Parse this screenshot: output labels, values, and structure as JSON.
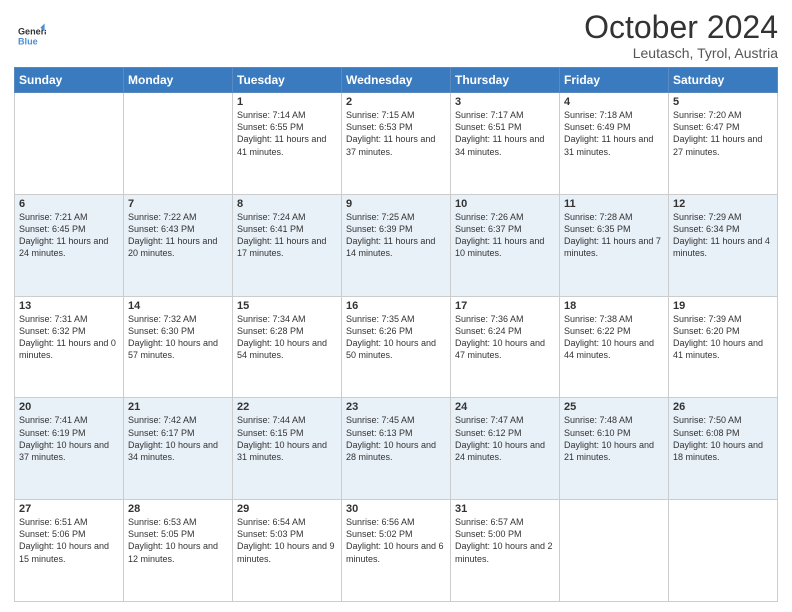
{
  "header": {
    "logo": {
      "line1": "General",
      "line2": "Blue"
    },
    "title": "October 2024",
    "location": "Leutasch, Tyrol, Austria"
  },
  "weekdays": [
    "Sunday",
    "Monday",
    "Tuesday",
    "Wednesday",
    "Thursday",
    "Friday",
    "Saturday"
  ],
  "weeks": [
    [
      {
        "day": "",
        "info": ""
      },
      {
        "day": "",
        "info": ""
      },
      {
        "day": "1",
        "info": "Sunrise: 7:14 AM\nSunset: 6:55 PM\nDaylight: 11 hours and 41 minutes."
      },
      {
        "day": "2",
        "info": "Sunrise: 7:15 AM\nSunset: 6:53 PM\nDaylight: 11 hours and 37 minutes."
      },
      {
        "day": "3",
        "info": "Sunrise: 7:17 AM\nSunset: 6:51 PM\nDaylight: 11 hours and 34 minutes."
      },
      {
        "day": "4",
        "info": "Sunrise: 7:18 AM\nSunset: 6:49 PM\nDaylight: 11 hours and 31 minutes."
      },
      {
        "day": "5",
        "info": "Sunrise: 7:20 AM\nSunset: 6:47 PM\nDaylight: 11 hours and 27 minutes."
      }
    ],
    [
      {
        "day": "6",
        "info": "Sunrise: 7:21 AM\nSunset: 6:45 PM\nDaylight: 11 hours and 24 minutes."
      },
      {
        "day": "7",
        "info": "Sunrise: 7:22 AM\nSunset: 6:43 PM\nDaylight: 11 hours and 20 minutes."
      },
      {
        "day": "8",
        "info": "Sunrise: 7:24 AM\nSunset: 6:41 PM\nDaylight: 11 hours and 17 minutes."
      },
      {
        "day": "9",
        "info": "Sunrise: 7:25 AM\nSunset: 6:39 PM\nDaylight: 11 hours and 14 minutes."
      },
      {
        "day": "10",
        "info": "Sunrise: 7:26 AM\nSunset: 6:37 PM\nDaylight: 11 hours and 10 minutes."
      },
      {
        "day": "11",
        "info": "Sunrise: 7:28 AM\nSunset: 6:35 PM\nDaylight: 11 hours and 7 minutes."
      },
      {
        "day": "12",
        "info": "Sunrise: 7:29 AM\nSunset: 6:34 PM\nDaylight: 11 hours and 4 minutes."
      }
    ],
    [
      {
        "day": "13",
        "info": "Sunrise: 7:31 AM\nSunset: 6:32 PM\nDaylight: 11 hours and 0 minutes."
      },
      {
        "day": "14",
        "info": "Sunrise: 7:32 AM\nSunset: 6:30 PM\nDaylight: 10 hours and 57 minutes."
      },
      {
        "day": "15",
        "info": "Sunrise: 7:34 AM\nSunset: 6:28 PM\nDaylight: 10 hours and 54 minutes."
      },
      {
        "day": "16",
        "info": "Sunrise: 7:35 AM\nSunset: 6:26 PM\nDaylight: 10 hours and 50 minutes."
      },
      {
        "day": "17",
        "info": "Sunrise: 7:36 AM\nSunset: 6:24 PM\nDaylight: 10 hours and 47 minutes."
      },
      {
        "day": "18",
        "info": "Sunrise: 7:38 AM\nSunset: 6:22 PM\nDaylight: 10 hours and 44 minutes."
      },
      {
        "day": "19",
        "info": "Sunrise: 7:39 AM\nSunset: 6:20 PM\nDaylight: 10 hours and 41 minutes."
      }
    ],
    [
      {
        "day": "20",
        "info": "Sunrise: 7:41 AM\nSunset: 6:19 PM\nDaylight: 10 hours and 37 minutes."
      },
      {
        "day": "21",
        "info": "Sunrise: 7:42 AM\nSunset: 6:17 PM\nDaylight: 10 hours and 34 minutes."
      },
      {
        "day": "22",
        "info": "Sunrise: 7:44 AM\nSunset: 6:15 PM\nDaylight: 10 hours and 31 minutes."
      },
      {
        "day": "23",
        "info": "Sunrise: 7:45 AM\nSunset: 6:13 PM\nDaylight: 10 hours and 28 minutes."
      },
      {
        "day": "24",
        "info": "Sunrise: 7:47 AM\nSunset: 6:12 PM\nDaylight: 10 hours and 24 minutes."
      },
      {
        "day": "25",
        "info": "Sunrise: 7:48 AM\nSunset: 6:10 PM\nDaylight: 10 hours and 21 minutes."
      },
      {
        "day": "26",
        "info": "Sunrise: 7:50 AM\nSunset: 6:08 PM\nDaylight: 10 hours and 18 minutes."
      }
    ],
    [
      {
        "day": "27",
        "info": "Sunrise: 6:51 AM\nSunset: 5:06 PM\nDaylight: 10 hours and 15 minutes."
      },
      {
        "day": "28",
        "info": "Sunrise: 6:53 AM\nSunset: 5:05 PM\nDaylight: 10 hours and 12 minutes."
      },
      {
        "day": "29",
        "info": "Sunrise: 6:54 AM\nSunset: 5:03 PM\nDaylight: 10 hours and 9 minutes."
      },
      {
        "day": "30",
        "info": "Sunrise: 6:56 AM\nSunset: 5:02 PM\nDaylight: 10 hours and 6 minutes."
      },
      {
        "day": "31",
        "info": "Sunrise: 6:57 AM\nSunset: 5:00 PM\nDaylight: 10 hours and 2 minutes."
      },
      {
        "day": "",
        "info": ""
      },
      {
        "day": "",
        "info": ""
      }
    ]
  ]
}
